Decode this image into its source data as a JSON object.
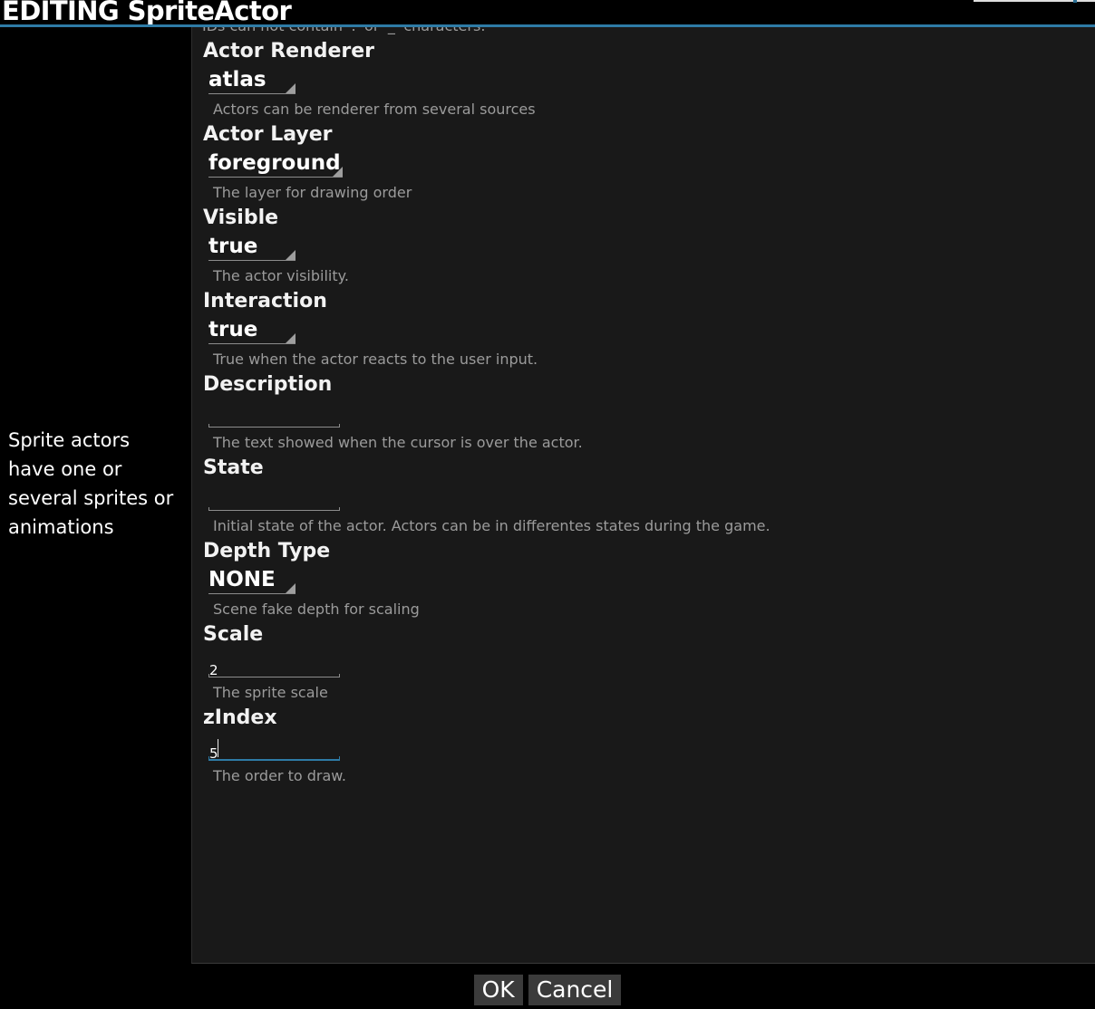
{
  "window": {
    "title": "EDITING SpriteActor"
  },
  "help": {
    "text": "Sprite actors have one or several sprites or animations"
  },
  "panel": {
    "clipped_hint": "IDs can not contain '.' or '_' characters.",
    "properties": [
      {
        "label": "Actor Renderer",
        "value": "atlas",
        "control": "select",
        "hint": "Actors can be renderer from several sources"
      },
      {
        "label": "Actor Layer",
        "value": "foreground",
        "control": "select",
        "hint": "The layer for drawing order"
      },
      {
        "label": "Visible",
        "value": "true",
        "control": "select",
        "hint": "The actor visibility."
      },
      {
        "label": "Interaction",
        "value": "true",
        "control": "select",
        "hint": "True when the actor reacts to the user input."
      },
      {
        "label": "Description",
        "value": "",
        "control": "text",
        "hint": "The text showed when the cursor is over the actor."
      },
      {
        "label": "State",
        "value": "",
        "control": "text",
        "hint": "Initial state of the actor. Actors can be in differentes states during the game."
      },
      {
        "label": "Depth Type",
        "value": "NONE",
        "control": "select",
        "hint": "Scene fake depth for scaling"
      },
      {
        "label": "Scale",
        "value": "2",
        "control": "text",
        "hint": "The sprite scale"
      },
      {
        "label": "zIndex",
        "value": "5",
        "control": "text",
        "focused": true,
        "hint": "The order to draw."
      }
    ]
  },
  "footer": {
    "ok_label": "OK",
    "cancel_label": "Cancel"
  },
  "colors": {
    "accent": "#2e7ba6",
    "panel_bg": "#191919",
    "window_bg": "#000000",
    "hint_text": "#9b9b9b",
    "button_bg": "#3b3b3b"
  }
}
